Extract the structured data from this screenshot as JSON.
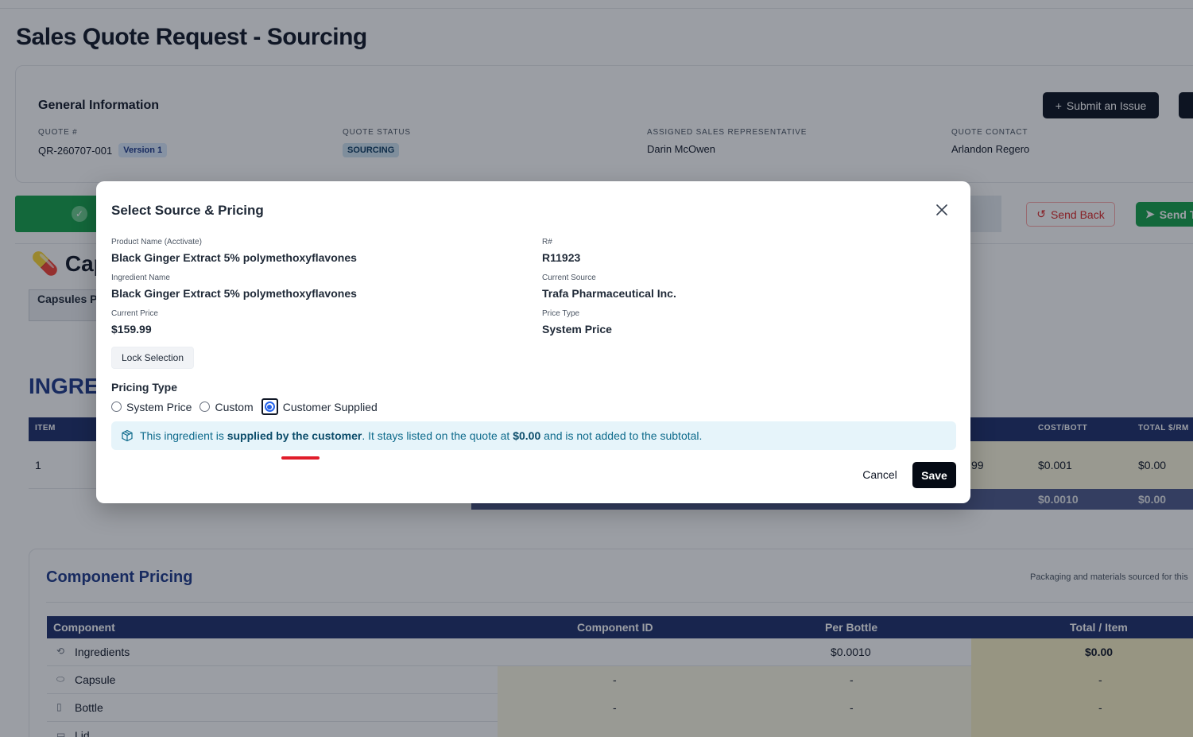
{
  "page": {
    "title": "Sales Quote Request - Sourcing"
  },
  "general": {
    "title": "General Information",
    "submit_issue_label": "Submit an Issue",
    "fields": {
      "quote_number_label": "QUOTE #",
      "quote_number": "QR-260707-001",
      "version": "Version 1",
      "status_label": "QUOTE STATUS",
      "status": "SOURCING",
      "rep_label": "ASSIGNED SALES REPRESENTATIVE",
      "rep": "Darin McOwen",
      "contact_label": "QUOTE CONTACT",
      "contact": "Arlandon Regero"
    }
  },
  "actions": {
    "send_back_label": "Send Back",
    "send_label": "Send T"
  },
  "capsule": {
    "title": "Cap",
    "tab": "Capsules P"
  },
  "ingredients": {
    "title": "INGRE",
    "columns": {
      "item": "ITEM",
      "cost_bott": "COST/BOTT",
      "total_rm": "TOTAL $/RM"
    },
    "row": {
      "item": "1",
      "partial": "99",
      "cost_bott": "$0.001",
      "total_rm": "$0.00"
    },
    "totals": {
      "cost_bott": "$0.0010",
      "total_rm": "$0.00"
    }
  },
  "components": {
    "title": "Component Pricing",
    "subtitle": "Packaging and materials sourced for this",
    "columns": {
      "component": "Component",
      "component_id": "Component ID",
      "per_bottle": "Per Bottle",
      "total_item": "Total / Item"
    },
    "rows": [
      {
        "name": "Ingredients",
        "id": "",
        "per_bottle": "$0.0010",
        "total": "$0.00"
      },
      {
        "name": "Capsule",
        "id": "-",
        "per_bottle": "-",
        "total": "-"
      },
      {
        "name": "Bottle",
        "id": "-",
        "per_bottle": "-",
        "total": "-"
      },
      {
        "name": "Lid",
        "id": "",
        "per_bottle": "",
        "total": ""
      }
    ]
  },
  "modal": {
    "title": "Select Source & Pricing",
    "product_name_label": "Product Name (Acctivate)",
    "product_name": "Black Ginger Extract 5% polymethoxyflavones",
    "r_label": "R#",
    "r_value": "R11923",
    "ingredient_name_label": "Ingredient Name",
    "ingredient_name": "Black Ginger Extract 5% polymethoxyflavones",
    "current_source_label": "Current Source",
    "current_source": "Trafa Pharmaceutical Inc.",
    "current_price_label": "Current Price",
    "current_price": "$159.99",
    "price_type_label": "Price Type",
    "price_type": "System Price",
    "lock_selection_label": "Lock Selection",
    "pricing_type_label": "Pricing Type",
    "pricing_options": [
      "System Price",
      "Custom",
      "Customer Supplied"
    ],
    "selected_option": "Customer Supplied",
    "notice": {
      "part1": "This ingredient is ",
      "bold1": "supplied by the customer",
      "part2": ". It stays listed on the quote at ",
      "bold2": "$0.00",
      "part3": " and is not added to the subtotal."
    },
    "cancel_label": "Cancel",
    "save_label": "Save"
  },
  "colors": {
    "accent_dark": "#050a14",
    "navy_header": "#1e2f6b",
    "success_green": "#16a34a",
    "danger_red": "#dc2626",
    "notice_bg": "#e6f4fa",
    "radio_blue": "#2563eb"
  },
  "icons": {
    "close": "close-icon",
    "notice": "box-icon",
    "plus": "plus-icon",
    "check": "check-icon",
    "undo": "undo-icon",
    "send": "send-icon",
    "pill": "pill-icon"
  }
}
